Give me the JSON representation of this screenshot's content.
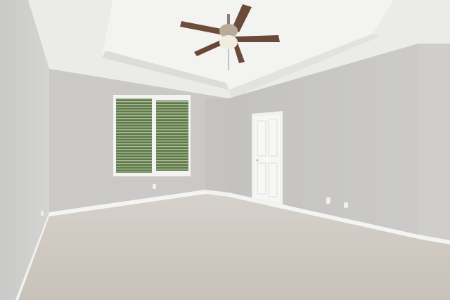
{
  "scene": {
    "kind": "empty-room-photo",
    "colors": {
      "ceiling": "#eeeeec",
      "wall_left": "#cfcfcd",
      "wall_back": "#c9c8c6",
      "wall_right": "#c6c5c3",
      "carpet": "#cfc9c2",
      "trim": "#f4f4f2",
      "fan_blade": "#6b4a3a",
      "window_green": "#4f6a3c"
    },
    "objects": [
      "ceiling-fan",
      "window-with-blinds",
      "interior-door",
      "wall-outlets",
      "carpet-floor"
    ]
  }
}
